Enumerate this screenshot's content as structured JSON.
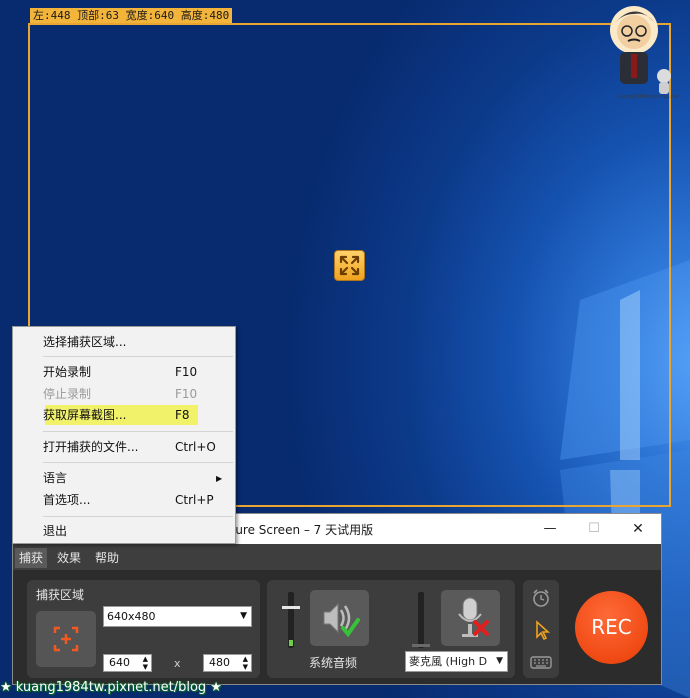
{
  "region_label": "左:448 顶部:63 宽度:640 高度:480",
  "window": {
    "title": "pture Screen – 7 天试用版",
    "minimize": "—",
    "maximize": "☐",
    "close": "✕"
  },
  "menubar": [
    "捕获",
    "效果",
    "帮助"
  ],
  "capture_area": {
    "title": "捕获区域",
    "size_value": "640x480",
    "width": "640",
    "times": "x",
    "height": "480"
  },
  "audio": {
    "system_label": "系统音频",
    "mic_value": "麥克風 (High D"
  },
  "rec_label": "REC",
  "context_menu": {
    "select_area": "选择捕获区域...",
    "start_recording": "开始录制",
    "start_shortcut": "F10",
    "stop_recording": "停止录制",
    "stop_shortcut": "F10",
    "screenshot": "获取屏幕截图...",
    "screenshot_shortcut": "F8",
    "open_captured": "打开捕获的文件...",
    "open_shortcut": "Ctrl+O",
    "language": "语言",
    "preferences": "首选项...",
    "preferences_shortcut": "Ctrl+P",
    "exit": "退出"
  },
  "avatar_caption": "kuang1984tw.pixnet.net",
  "watermark": "★ kuang1984tw.pixnet.net/blog ★",
  "colors": {
    "region_border": "#e9a531",
    "rec": "#f04a14",
    "highlight": "#f2f26a",
    "panel": "#3d3d3d"
  },
  "icons": [
    "move-arrows-icon",
    "capture-area-icon",
    "speaker-check-icon",
    "microphone-muted-icon",
    "alarm-clock-icon",
    "cursor-icon",
    "keyboard-icon"
  ]
}
